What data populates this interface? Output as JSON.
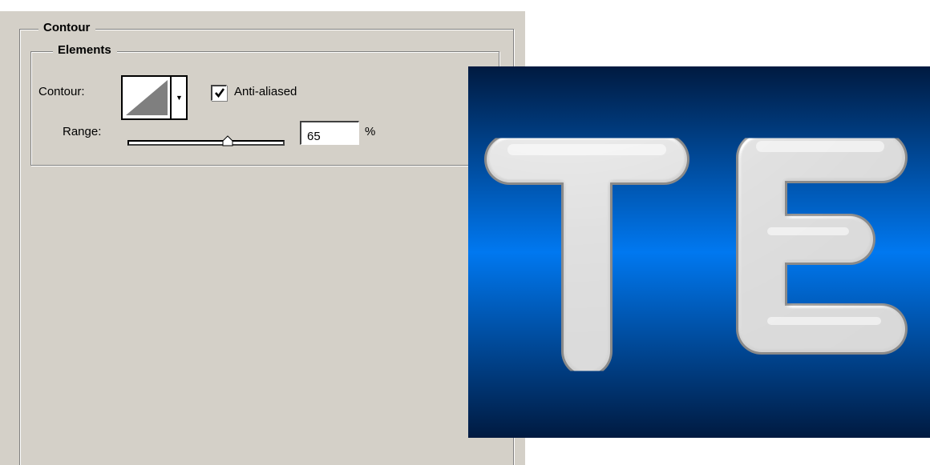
{
  "dialog": {
    "section_title": "Contour",
    "group_title": "Elements",
    "contour_label": "Contour:",
    "anti_aliased_label": "Anti-aliased",
    "anti_aliased_checked": true,
    "range_label": "Range:",
    "range_value": "65",
    "range_unit": "%",
    "range_slider_level": 0.65
  },
  "preview": {
    "text": "TE",
    "background_colors": [
      "#001a40",
      "#0078f0",
      "#001a40"
    ],
    "letter_color": "#d3d3d3"
  }
}
